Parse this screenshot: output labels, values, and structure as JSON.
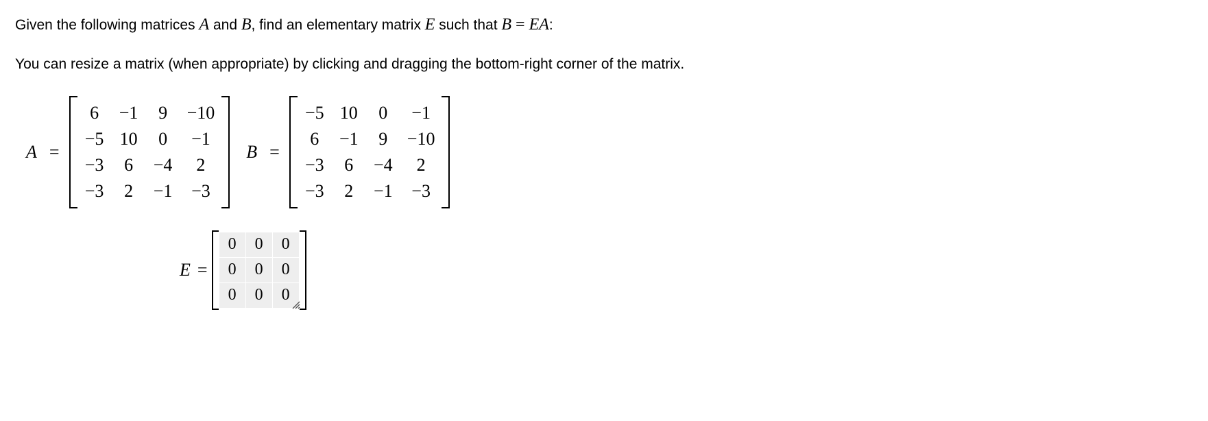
{
  "problem": {
    "line1_prefix": "Given the following matrices ",
    "line1_mid1": " and ",
    "line1_mid2": ", find an elementary matrix ",
    "line1_mid3": " such that ",
    "line1_suffix": ":",
    "var_A": "A",
    "var_B": "B",
    "var_E": "E",
    "eq_lhs": "B",
    "eq_op": " = ",
    "eq_rhs": "EA",
    "line2": "You can resize a matrix (when appropriate) by clicking and dragging the bottom-right corner of the matrix."
  },
  "A": {
    "label": "A",
    "rows": [
      [
        "6",
        "−1",
        "9",
        "−10"
      ],
      [
        "−5",
        "10",
        "0",
        "−1"
      ],
      [
        "−3",
        "6",
        "−4",
        "2"
      ],
      [
        "−3",
        "2",
        "−1",
        "−3"
      ]
    ]
  },
  "B": {
    "label": "B",
    "rows": [
      [
        "−5",
        "10",
        "0",
        "−1"
      ],
      [
        "6",
        "−1",
        "9",
        "−10"
      ],
      [
        "−3",
        "6",
        "−4",
        "2"
      ],
      [
        "−3",
        "2",
        "−1",
        "−3"
      ]
    ]
  },
  "E": {
    "label": "E",
    "rows": [
      [
        "0",
        "0",
        "0"
      ],
      [
        "0",
        "0",
        "0"
      ],
      [
        "0",
        "0",
        "0"
      ]
    ]
  },
  "equals": "="
}
